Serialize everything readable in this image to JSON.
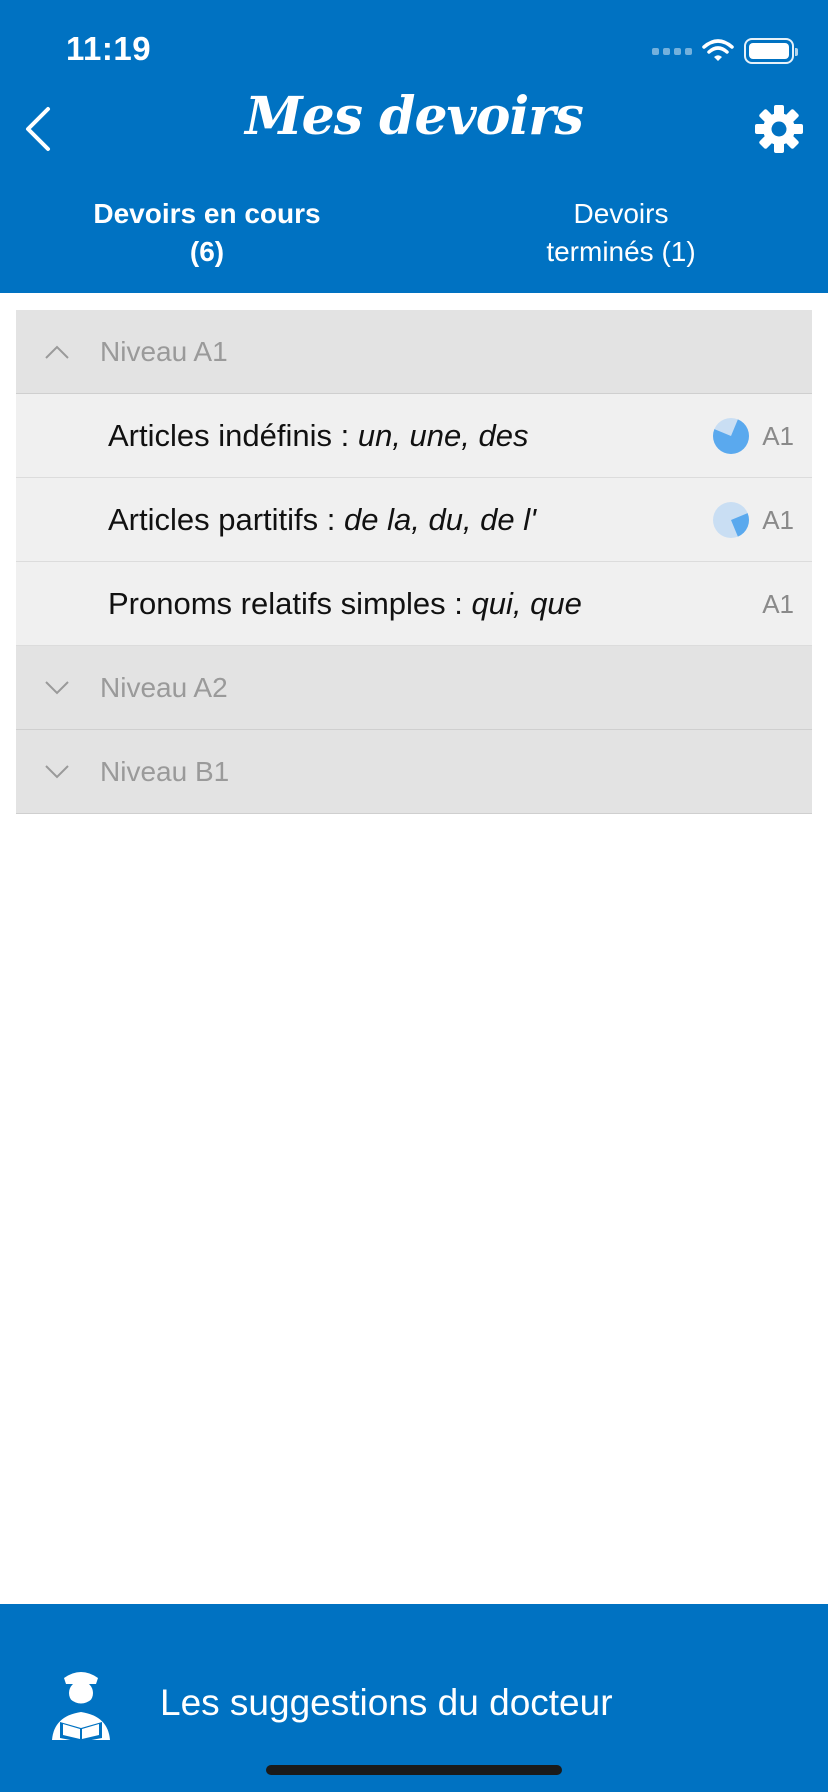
{
  "status_bar": {
    "time": "11:19"
  },
  "header": {
    "title": "Mes devoirs"
  },
  "tabs": [
    {
      "line1": "Devoirs en cours",
      "line2": "(6)",
      "active": true
    },
    {
      "line1": "Devoirs",
      "line2": "terminés (1)",
      "active": false
    }
  ],
  "groups": [
    {
      "label": "Niveau A1",
      "expanded": true,
      "items": [
        {
          "title_plain": "Articles indéfinis : ",
          "title_italic": "un, une, des",
          "level": "A1",
          "progress": 0.75
        },
        {
          "title_plain": "Articles partitifs : ",
          "title_italic": "de la, du, de l'",
          "level": "A1",
          "progress": 0.25
        },
        {
          "title_plain": "Pronoms relatifs simples : ",
          "title_italic": "qui, que",
          "level": "A1",
          "progress": null
        }
      ]
    },
    {
      "label": "Niveau A2",
      "expanded": false,
      "items": []
    },
    {
      "label": "Niveau B1",
      "expanded": false,
      "items": []
    }
  ],
  "bottom_bar": {
    "label": "Les suggestions du docteur"
  },
  "colors": {
    "primary": "#0072c2",
    "pie_fill": "#5aa9ee",
    "pie_bg": "#c9def3",
    "group_bg": "#e3e3e3",
    "item_bg": "#f0f0f0"
  },
  "icons": {
    "back": "chevron-left-icon",
    "settings": "gear-icon",
    "collapse": "chevron-up-icon",
    "expand": "chevron-down-icon",
    "doctor": "doctor-reading-icon",
    "progress": "progress-pie-icon"
  }
}
